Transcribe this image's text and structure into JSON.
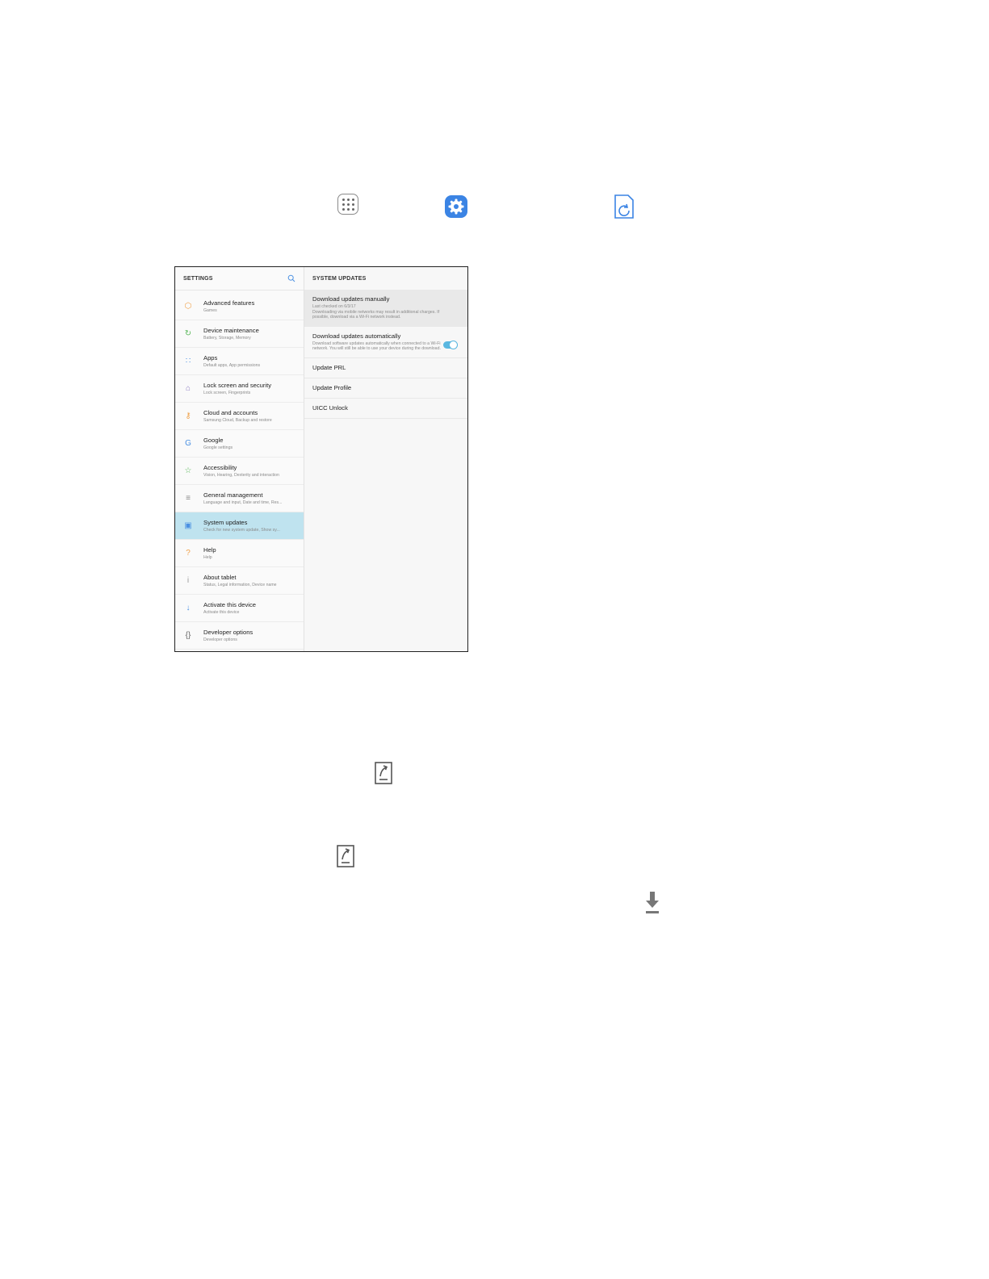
{
  "colors": {
    "accent": "#3b84e4",
    "selected_row": "#bfe3ef",
    "toggle_on": "#5ab7e0"
  },
  "instruction_icons": [
    "apps-icon",
    "settings-icon",
    "system-updates-icon"
  ],
  "settings": {
    "left_header": "SETTINGS",
    "right_header": "SYSTEM UPDATES",
    "menu": [
      {
        "title": "Advanced features",
        "sub": "Games",
        "icon": "hexagon-plus-icon",
        "color": "#f0a24a"
      },
      {
        "title": "Device maintenance",
        "sub": "Battery, Storage, Memory",
        "icon": "refresh-circle-icon",
        "color": "#5cb85c"
      },
      {
        "title": "Apps",
        "sub": "Default apps, App permissions",
        "icon": "apps-grid-icon",
        "color": "#4a90e2"
      },
      {
        "title": "Lock screen and security",
        "sub": "Lock screen, Fingerprints",
        "icon": "lock-icon",
        "color": "#8e7cc3"
      },
      {
        "title": "Cloud and accounts",
        "sub": "Samsung Cloud, Backup and restore",
        "icon": "key-icon",
        "color": "#f0a24a"
      },
      {
        "title": "Google",
        "sub": "Google settings",
        "icon": "google-icon",
        "color": "#4a90e2"
      },
      {
        "title": "Accessibility",
        "sub": "Vision, Hearing, Dexterity and interaction",
        "icon": "accessibility-icon",
        "color": "#5cb85c"
      },
      {
        "title": "General management",
        "sub": "Language and input, Date and time, Res...",
        "icon": "sliders-icon",
        "color": "#888888"
      },
      {
        "title": "System updates",
        "sub": "Check for new system update, Show sy...",
        "icon": "system-update-icon",
        "color": "#4a90e2"
      },
      {
        "title": "Help",
        "sub": "Help",
        "icon": "help-icon",
        "color": "#f0a24a"
      },
      {
        "title": "About tablet",
        "sub": "Status, Legal information, Device name",
        "icon": "info-icon",
        "color": "#999999"
      },
      {
        "title": "Activate this device",
        "sub": "Activate this device",
        "icon": "activate-icon",
        "color": "#4a90e2"
      },
      {
        "title": "Developer options",
        "sub": "Developer options",
        "icon": "braces-icon",
        "color": "#666666"
      }
    ],
    "options": {
      "manual_title": "Download updates manually",
      "manual_sub": "Last checked on 6/3/17\nDownloading via mobile networks may result in additional charges. If possible, download via a Wi-Fi network instead.",
      "auto_title": "Download updates automatically",
      "auto_sub": "Download software updates automatically when connected to a Wi-Fi network. You will still be able to use your device during the download.",
      "auto_enabled": true,
      "prl": "Update PRL",
      "profile": "Update Profile",
      "uicc": "UICC Unlock"
    }
  }
}
